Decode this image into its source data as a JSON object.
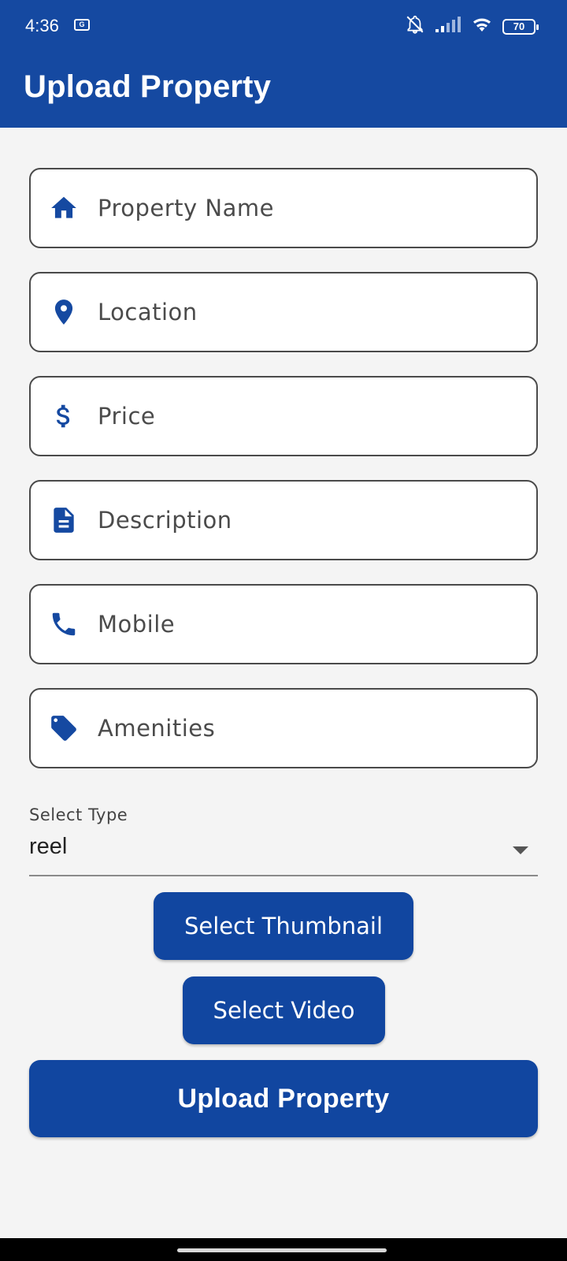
{
  "status_bar": {
    "time": "4:36",
    "notification_icon": "g-square-icon",
    "battery_level": "70",
    "icons": [
      "bell-off-icon",
      "signal-icon",
      "wifi-icon",
      "battery-icon"
    ]
  },
  "app_bar": {
    "title": "Upload Property"
  },
  "form": {
    "fields": [
      {
        "icon": "home-icon",
        "placeholder": "Property Name"
      },
      {
        "icon": "location-pin-icon",
        "placeholder": "Location"
      },
      {
        "icon": "dollar-icon",
        "placeholder": "Price"
      },
      {
        "icon": "document-icon",
        "placeholder": "Description"
      },
      {
        "icon": "phone-icon",
        "placeholder": "Mobile"
      },
      {
        "icon": "tag-icon",
        "placeholder": "Amenities"
      }
    ],
    "select_type": {
      "label": "Select Type",
      "value": "reel"
    },
    "buttons": {
      "select_thumbnail": "Select Thumbnail",
      "select_video": "Select Video",
      "upload_property": "Upload Property"
    }
  },
  "colors": {
    "primary": "#1549a1",
    "background": "#f4f4f4",
    "field_border": "#4a4a4a"
  }
}
